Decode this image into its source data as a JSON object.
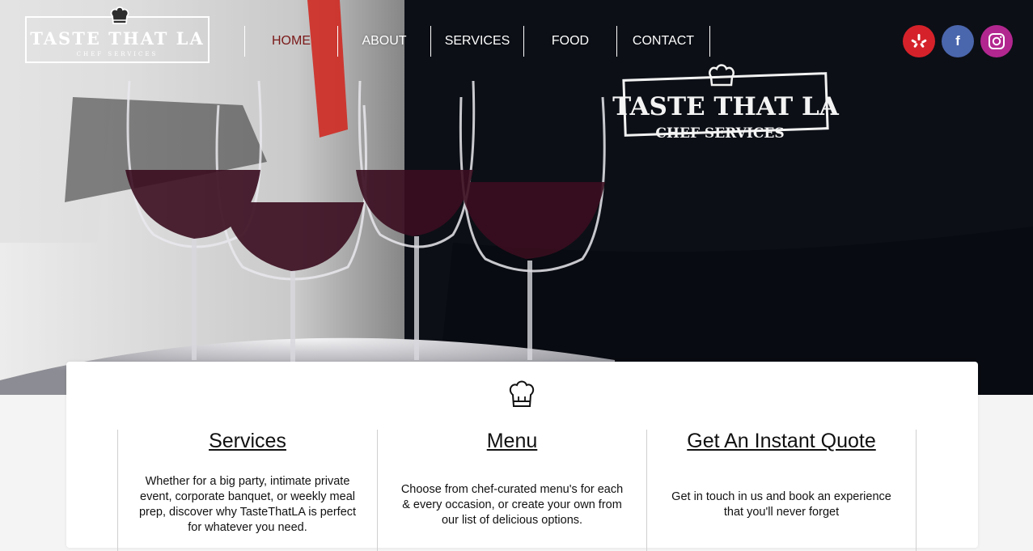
{
  "brand": {
    "logo_title": "TASTE THAT LA",
    "logo_subtitle": "CHEF SERVICES",
    "apron_title": "TASTE THAT LA",
    "apron_subtitle": "CHEF SERVICES"
  },
  "nav": {
    "items": [
      {
        "label": "HOME",
        "active": true
      },
      {
        "label": "ABOUT"
      },
      {
        "label": "SERVICES"
      },
      {
        "label": "FOOD"
      },
      {
        "label": "CONTACT"
      }
    ]
  },
  "social": [
    {
      "icon": "yelp-icon",
      "color": "#d5222a"
    },
    {
      "icon": "facebook-icon",
      "color": "#4a66ad",
      "glyph": "f"
    },
    {
      "icon": "instagram-icon",
      "color": "#b2278f"
    }
  ],
  "sections": [
    {
      "title": "Services",
      "lines": [
        "Whether for a big party, intimate private",
        "event, corporate banquet, or weekly meal",
        "prep, discover why TasteThatLA is perfect",
        "for whatever you need."
      ]
    },
    {
      "title": "Menu",
      "lines": [
        "Choose from chef-curated menu's for each",
        "& every occasion, or create your own from",
        "our list of delicious options."
      ]
    },
    {
      "title": "Get An Instant Quote",
      "lines": [
        "Get in touch in us and book an experience",
        "that you'll never forget"
      ]
    }
  ],
  "colors": {
    "active_nav": "#7a1818",
    "hero_dark": "#0b0e14"
  }
}
